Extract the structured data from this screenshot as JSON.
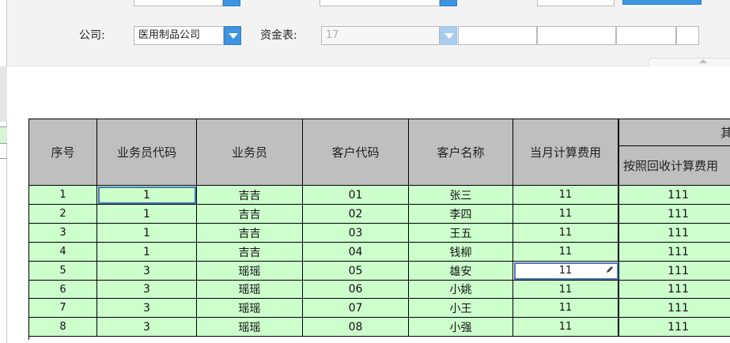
{
  "filters": {
    "company_label": "公司:",
    "company_value": "医用制品公司",
    "fund_label": "资金表:",
    "fund_value": "17"
  },
  "table": {
    "headers": {
      "seq": "序号",
      "rep_code": "业务员代码",
      "rep_name": "业务员",
      "cust_code": "客户代码",
      "cust_name": "客户名称",
      "month_fee": "当月计算费用",
      "group_partial": "其",
      "recovery_fee": "按照回收计算费用"
    },
    "rows": [
      {
        "seq": "1",
        "rep_code": "1",
        "rep_name": "吉吉",
        "cust_code": "01",
        "cust_name": "张三",
        "month_fee": "11",
        "recovery_fee": "111"
      },
      {
        "seq": "2",
        "rep_code": "1",
        "rep_name": "吉吉",
        "cust_code": "02",
        "cust_name": "李四",
        "month_fee": "11",
        "recovery_fee": "111"
      },
      {
        "seq": "3",
        "rep_code": "1",
        "rep_name": "吉吉",
        "cust_code": "03",
        "cust_name": "王五",
        "month_fee": "11",
        "recovery_fee": "111"
      },
      {
        "seq": "4",
        "rep_code": "1",
        "rep_name": "吉吉",
        "cust_code": "04",
        "cust_name": "钱柳",
        "month_fee": "11",
        "recovery_fee": "111"
      },
      {
        "seq": "5",
        "rep_code": "3",
        "rep_name": "瑶瑶",
        "cust_code": "05",
        "cust_name": "雄安",
        "month_fee": "11",
        "recovery_fee": "111"
      },
      {
        "seq": "6",
        "rep_code": "3",
        "rep_name": "瑶瑶",
        "cust_code": "06",
        "cust_name": "小姚",
        "month_fee": "11",
        "recovery_fee": "111"
      },
      {
        "seq": "7",
        "rep_code": "3",
        "rep_name": "瑶瑶",
        "cust_code": "07",
        "cust_name": "小王",
        "month_fee": "11",
        "recovery_fee": "111"
      },
      {
        "seq": "8",
        "rep_code": "3",
        "rep_name": "瑶瑶",
        "cust_code": "08",
        "cust_name": "小强",
        "month_fee": "11",
        "recovery_fee": "111"
      }
    ],
    "selected_row": 1,
    "editing_row": 5
  },
  "colors": {
    "header_bg": "#bfbfbf",
    "row_bg": "#ccffcc",
    "accent": "#3d94e0"
  }
}
